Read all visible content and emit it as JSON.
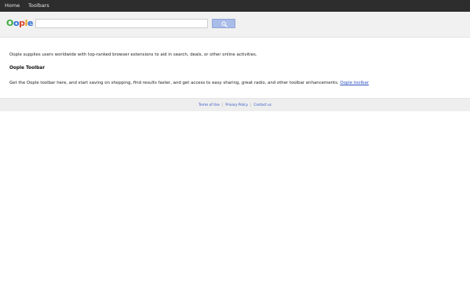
{
  "nav": {
    "items": [
      {
        "label": "Home"
      },
      {
        "label": "Toolbars"
      }
    ]
  },
  "header": {
    "logo": {
      "letters": [
        "O",
        "o",
        "p",
        "l",
        "e"
      ],
      "colors": [
        "#3aa83e",
        "#2a6fd6",
        "#d9442a",
        "#f0a21a",
        "#2a6fd6"
      ]
    },
    "search": {
      "value": "",
      "placeholder": "",
      "button_icon": "search-icon"
    }
  },
  "content": {
    "intro": "Oople supplies users worldwide with top-ranked browser extensions to aid in search, deals, or other online activities.",
    "section_heading": "Oople Toolbar",
    "section_text": "Get the Oople toolbar here, and start saving on shopping, find results faster, and get access to easy sharing, great radio, and other toolbar enhancements. ",
    "section_link": "Oople toolbar"
  },
  "footer": {
    "links": [
      {
        "label": "Terms of Use"
      },
      {
        "label": "Privacy Policy"
      },
      {
        "label": "Contact us"
      }
    ],
    "separator": "|"
  },
  "colors": {
    "nav_background": "#2d2d2d",
    "header_background": "#f1f1f1",
    "link": "#2a4fc0",
    "search_button": "#aabce8"
  }
}
